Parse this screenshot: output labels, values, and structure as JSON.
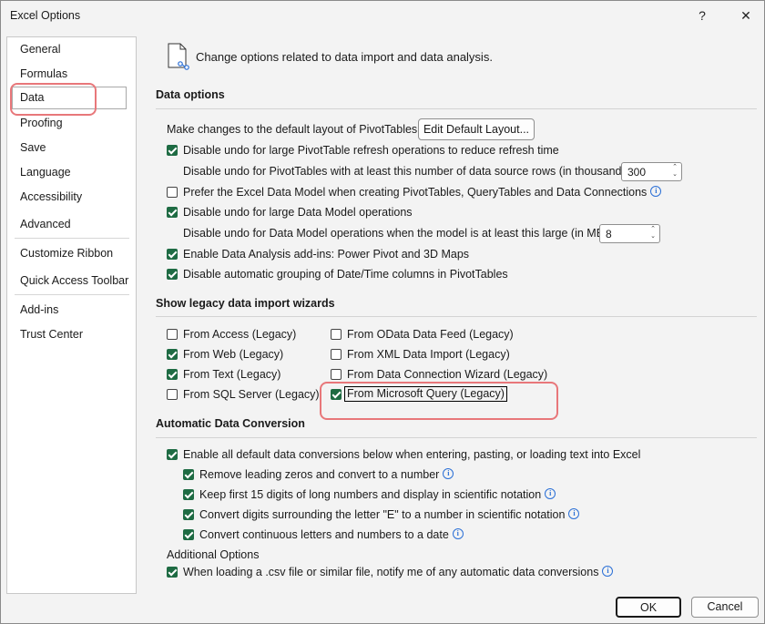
{
  "window": {
    "title": "Excel Options",
    "help_label": "?",
    "close_label": "✕"
  },
  "sidebar": {
    "items": [
      {
        "label": "General"
      },
      {
        "label": "Formulas"
      },
      {
        "label": "Data"
      },
      {
        "label": "Proofing"
      },
      {
        "label": "Save"
      },
      {
        "label": "Language"
      },
      {
        "label": "Accessibility"
      },
      {
        "label": "Advanced"
      },
      {
        "label": "Customize Ribbon"
      },
      {
        "label": "Quick Access Toolbar"
      },
      {
        "label": "Add-ins"
      },
      {
        "label": "Trust Center"
      }
    ],
    "selected": "Data"
  },
  "header": {
    "text": "Change options related to data import and data analysis."
  },
  "data_options": {
    "title": "Data options",
    "pivot_layout_label": "Make changes to the default layout of PivotTables:",
    "edit_layout_button": "Edit Default Layout...",
    "opt1": {
      "label": "Disable undo for large PivotTable refresh operations to reduce refresh time",
      "checked": true
    },
    "opt1_sub_label": "Disable undo for PivotTables with at least this number of data source rows (in thousands):",
    "opt1_sub_value": "300",
    "opt2": {
      "label": "Prefer the Excel Data Model when creating PivotTables, QueryTables and Data Connections",
      "checked": false
    },
    "opt3": {
      "label": "Disable undo for large Data Model operations",
      "checked": true
    },
    "opt3_sub_label": "Disable undo for Data Model operations when the model is at least this large (in MB):",
    "opt3_sub_value": "8",
    "opt4": {
      "label": "Enable Data Analysis add-ins: Power Pivot and 3D Maps",
      "checked": true
    },
    "opt5": {
      "label": "Disable automatic grouping of Date/Time columns in PivotTables",
      "checked": true
    }
  },
  "legacy": {
    "title": "Show legacy data import wizards",
    "left": [
      {
        "label": "From Access (Legacy)",
        "checked": false
      },
      {
        "label": "From Web (Legacy)",
        "checked": true
      },
      {
        "label": "From Text (Legacy)",
        "checked": true
      },
      {
        "label": "From SQL Server (Legacy)",
        "checked": false
      }
    ],
    "right": [
      {
        "label": "From OData Data Feed (Legacy)",
        "checked": false
      },
      {
        "label": "From XML Data Import (Legacy)",
        "checked": false
      },
      {
        "label": "From Data Connection Wizard (Legacy)",
        "checked": false
      },
      {
        "label": "From Microsoft Query (Legacy)",
        "checked": true
      }
    ]
  },
  "conversion": {
    "title": "Automatic Data Conversion",
    "enable_all": {
      "label": "Enable all default data conversions below when entering, pasting, or loading text into Excel",
      "checked": true
    },
    "items": [
      {
        "label": "Remove leading zeros and convert to a number",
        "checked": true
      },
      {
        "label": "Keep first 15 digits of long numbers and display in scientific notation",
        "checked": true
      },
      {
        "label": "Convert digits surrounding the letter \"E\" to a number in scientific notation",
        "checked": true
      },
      {
        "label": "Convert continuous letters and numbers to a date",
        "checked": true
      }
    ],
    "additional_title": "Additional Options",
    "csv_notify": {
      "label": "When loading a .csv file or similar file, notify me of any automatic data conversions",
      "checked": true
    }
  },
  "footer": {
    "ok_label": "OK",
    "cancel_label": "Cancel"
  },
  "colors": {
    "accent": "#1e6b43",
    "highlight": "#e8777a"
  }
}
